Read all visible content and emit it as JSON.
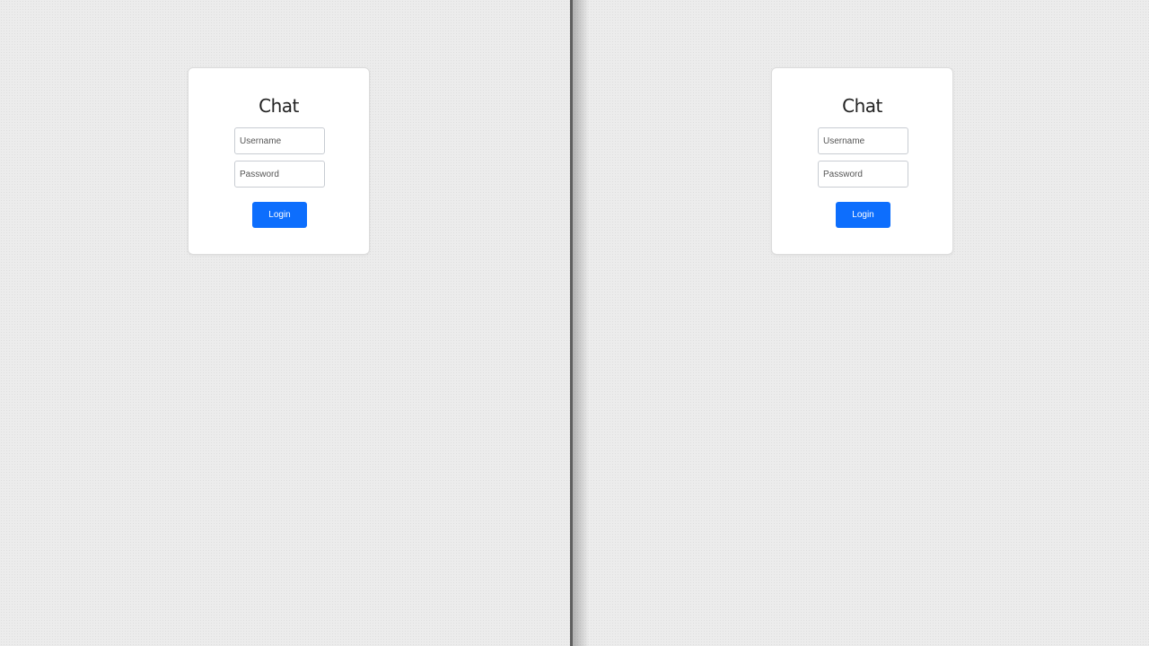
{
  "panels": [
    {
      "title": "Chat",
      "username": {
        "placeholder": "Username",
        "value": ""
      },
      "password": {
        "placeholder": "Password",
        "value": ""
      },
      "login_label": "Login"
    },
    {
      "title": "Chat",
      "username": {
        "placeholder": "Username",
        "value": ""
      },
      "password": {
        "placeholder": "Password",
        "value": ""
      },
      "login_label": "Login"
    }
  ],
  "colors": {
    "accent": "#0d6efd",
    "background": "#ececec",
    "card": "#ffffff",
    "divider": "#5f5f5f"
  }
}
